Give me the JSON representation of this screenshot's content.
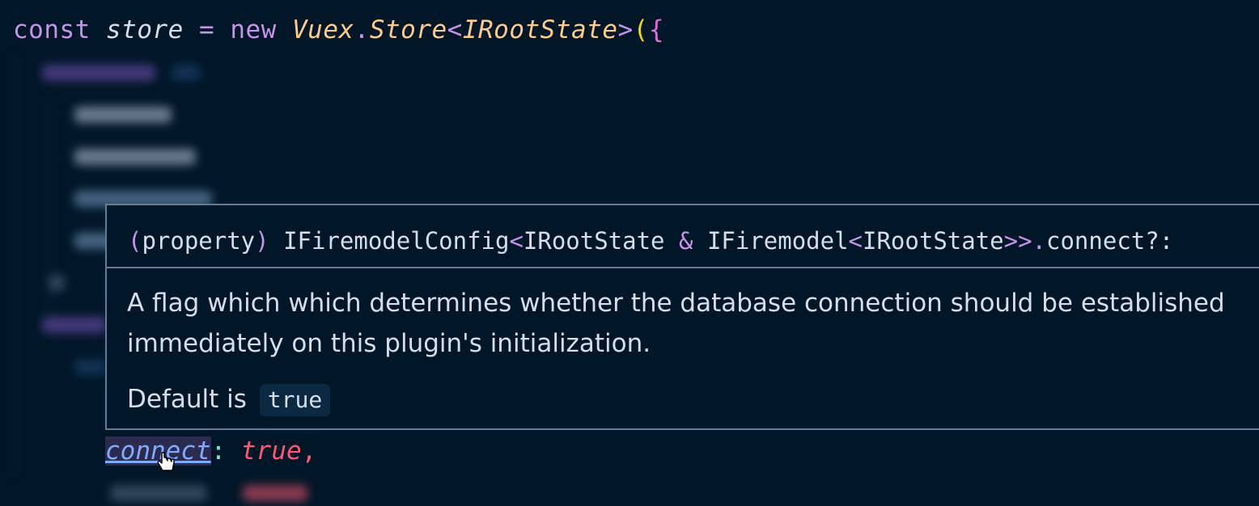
{
  "editor": {
    "top_line": {
      "const": "const",
      "store": "store",
      "eq": "=",
      "new": "new",
      "vuex": "Vuex",
      "dot": ".",
      "store_class": "Store",
      "lt": "<",
      "type": "IRootState",
      "gt": ">",
      "paren": "(",
      "brace": "{"
    },
    "hover_line": {
      "word": "connect",
      "colon": ":",
      "value": "true",
      "comma": ","
    }
  },
  "tooltip": {
    "signature": {
      "open_paren": "(",
      "kind": "property",
      "close_paren": ")",
      "type1": "IFiremodelConfig",
      "lt1": "<",
      "type2": "IRootState",
      "amp": "&",
      "type3": "IFiremodel",
      "lt2": "<",
      "type4": "IRootState",
      "gt": ">>",
      "dot": ".",
      "member": "connect?:"
    },
    "description": "A flag which which determines whether the database connection should be established immediately on this plugin's initialization.",
    "default_label": "Default is",
    "default_value": "true"
  },
  "colors": {
    "background": "#011627",
    "tooltip_border": "#5f7e97",
    "hover_highlight": "#2b2a4f"
  },
  "icons": {
    "cursor": "hand-pointer-icon"
  }
}
